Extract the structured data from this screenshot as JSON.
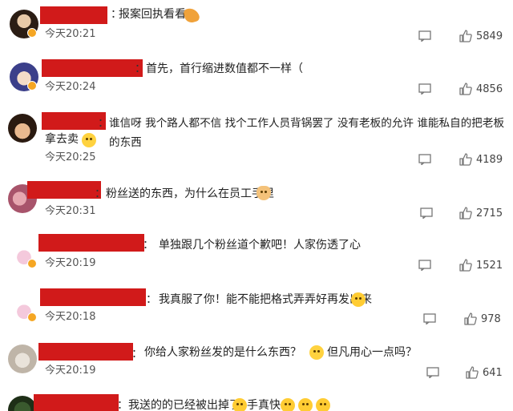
{
  "comments": [
    {
      "text": "报案回执看看",
      "time": "今天20:21",
      "likes": "5849",
      "emoji": "hand-emoji"
    },
    {
      "text": "首先，首行缩进数值都不一样（",
      "time": "今天20:24",
      "likes": "4856"
    },
    {
      "text": "谁信呀 我个路人都不信 找个工作人员背锅罢了 没有老板的允许 谁能私自的把老板的东西",
      "text2": "拿去卖",
      "time": "今天20:25",
      "likes": "4189",
      "emoji": "smirk-emoji"
    },
    {
      "text": "粉丝送的东西，为什么在员工手里",
      "time": "今天20:31",
      "likes": "2715",
      "emoji": "cat-emoji"
    },
    {
      "text": "单独跟几个粉丝道个歉吧！人家伤透了心",
      "time": "今天20:19",
      "likes": "1521"
    },
    {
      "text": "我真服了你！能不能把格式弄弄好再发出来",
      "time": "今天20:18",
      "likes": "978",
      "emoji": "laugh-cry-emoji"
    },
    {
      "text": "你给人家粉丝发的是什么东西？",
      "text2": "但凡用心一点吗？",
      "time": "今天20:19",
      "likes": "641",
      "emoji": "scream-emoji"
    },
    {
      "text": "我送的的已经被出掉了",
      "text2": "手真快",
      "emoji": "cry-emoji"
    }
  ],
  "colors": {
    "redaction": "#d11a1a",
    "badge": "#f5a623"
  }
}
